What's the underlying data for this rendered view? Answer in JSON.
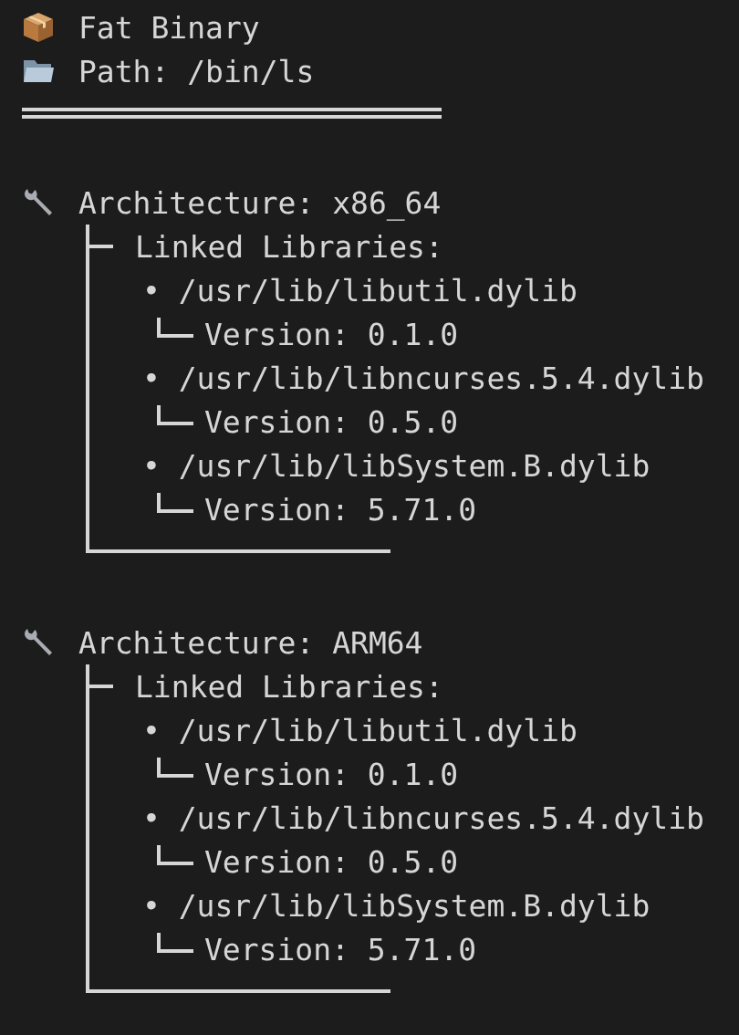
{
  "header": [
    {
      "kind": "package",
      "text": "Fat Binary"
    },
    {
      "kind": "folder",
      "text": "Path: /bin/ls"
    }
  ],
  "architectures": [
    {
      "label": "Architecture: x86_64",
      "section_label": "Linked Libraries:",
      "libraries": [
        {
          "path": "• /usr/lib/libutil.dylib",
          "version": "Version: 0.1.0"
        },
        {
          "path": "• /usr/lib/libncurses.5.4.dylib",
          "version": "Version: 0.5.0"
        },
        {
          "path": "• /usr/lib/libSystem.B.dylib",
          "version": "Version: 5.71.0"
        }
      ]
    },
    {
      "label": "Architecture: ARM64",
      "section_label": "Linked Libraries:",
      "libraries": [
        {
          "path": "• /usr/lib/libutil.dylib",
          "version": "Version: 0.1.0"
        },
        {
          "path": "• /usr/lib/libncurses.5.4.dylib",
          "version": "Version: 0.5.0"
        },
        {
          "path": "• /usr/lib/libSystem.B.dylib",
          "version": "Version: 5.71.0"
        }
      ]
    }
  ]
}
